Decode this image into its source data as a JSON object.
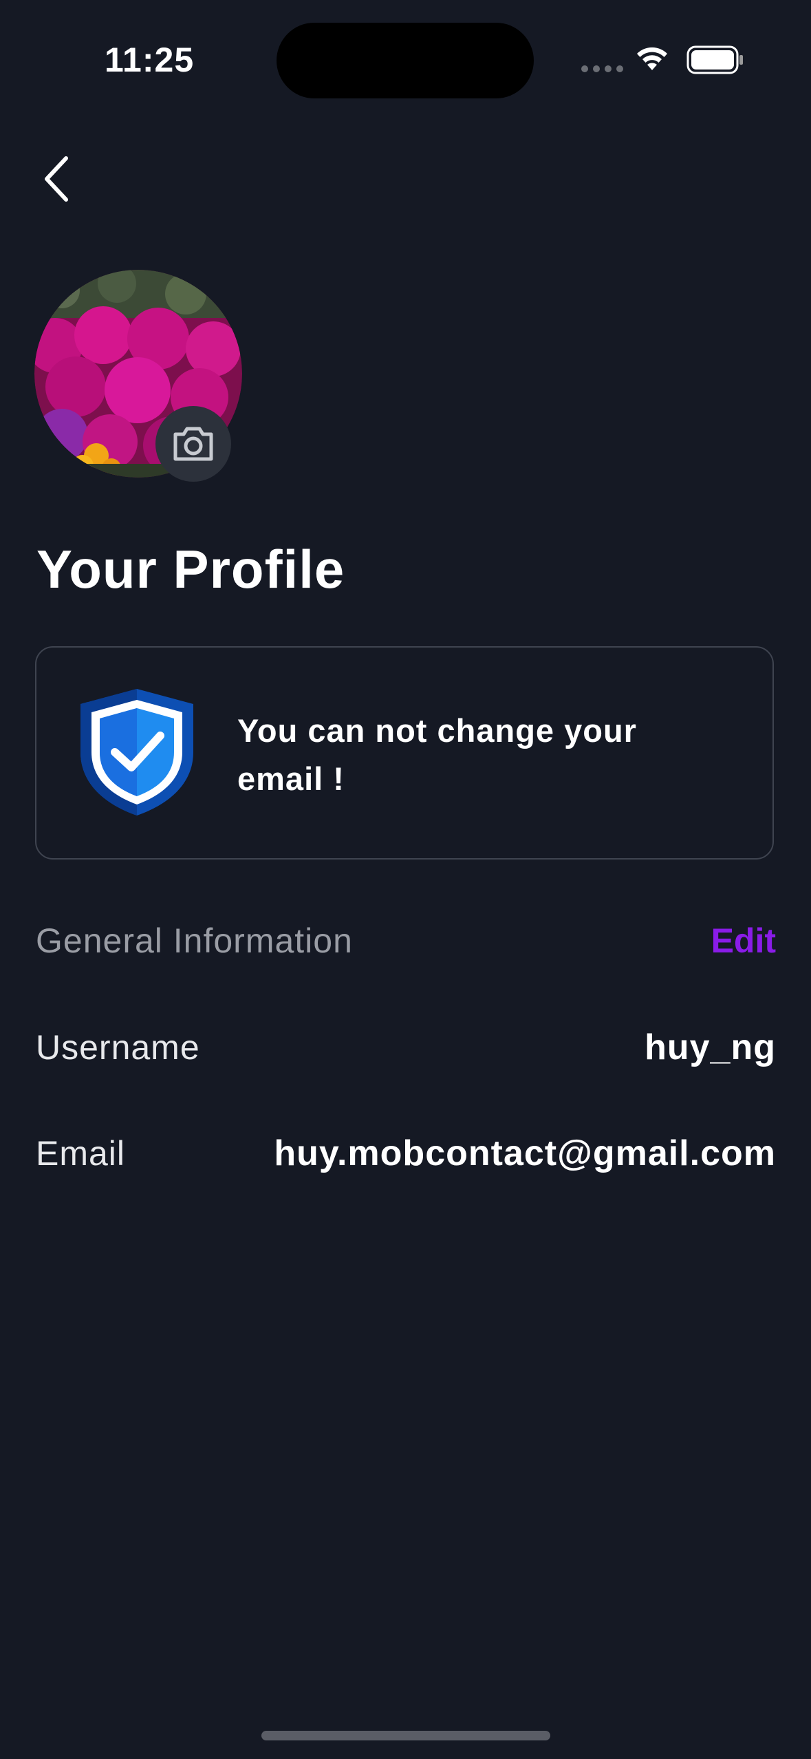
{
  "status_bar": {
    "time": "11:25"
  },
  "page": {
    "title": "Your Profile"
  },
  "notice": {
    "message": "You can not change your email !"
  },
  "general": {
    "title": "General Information",
    "edit_label": "Edit"
  },
  "fields": {
    "username": {
      "label": "Username",
      "value": "huy_ng"
    },
    "email": {
      "label": "Email",
      "value": "huy.mobcontact@gmail.com"
    }
  },
  "colors": {
    "background": "#151924",
    "accent": "#8a1ce8",
    "shield": "#1565d8"
  },
  "icons": [
    "back-chevron-icon",
    "camera-icon",
    "shield-check-icon",
    "wifi-icon",
    "battery-icon"
  ]
}
